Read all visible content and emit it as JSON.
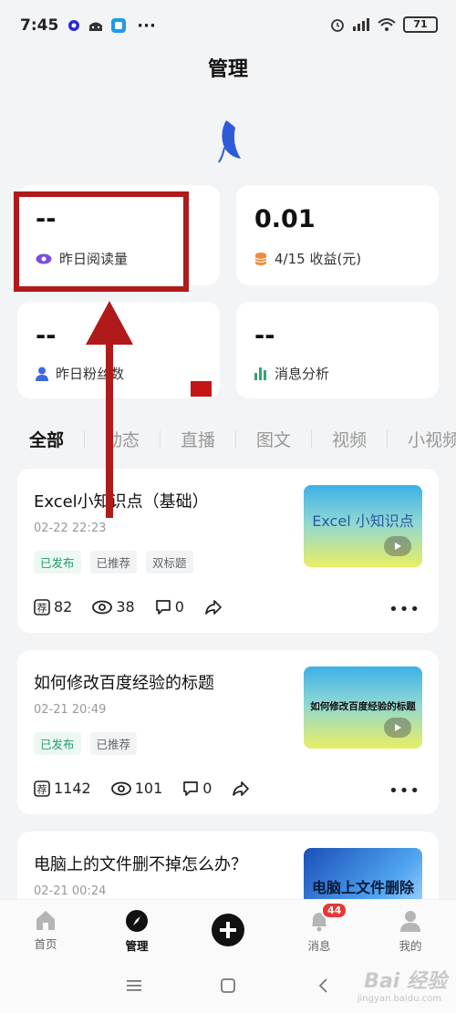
{
  "status_bar": {
    "time": "7:45",
    "battery": "71"
  },
  "header": {
    "title": "管理"
  },
  "stats": [
    {
      "value": "--",
      "label": "昨日阅读量",
      "icon": "eye-icon"
    },
    {
      "value": "0.01",
      "label": "4/15 收益(元)",
      "icon": "coins-icon"
    },
    {
      "value": "--",
      "label": "昨日粉丝数",
      "icon": "person-icon"
    },
    {
      "value": "--",
      "label": "消息分析",
      "icon": "bar-chart-icon"
    }
  ],
  "tabs": [
    "全部",
    "动态",
    "直播",
    "图文",
    "视频",
    "小视频"
  ],
  "active_tab": "全部",
  "articles": [
    {
      "title": "Excel小知识点（基础）",
      "date": "02-22 22:23",
      "tags": [
        "已发布",
        "已推荐",
        "双标题"
      ],
      "thumb_text": "Excel 小知识点",
      "recommend": "82",
      "views": "38",
      "comments": "0"
    },
    {
      "title": "如何修改百度经验的标题",
      "date": "02-21 20:49",
      "tags": [
        "已发布",
        "已推荐"
      ],
      "thumb_text": "如何修改百度经验的标题",
      "recommend": "1142",
      "views": "101",
      "comments": "0"
    },
    {
      "title": "电脑上的文件删不掉怎么办？",
      "date": "02-21 00:24",
      "thumb_text": "电脑上文件删除"
    }
  ],
  "bottom_nav": {
    "home": "首页",
    "manage": "管理",
    "messages": "消息",
    "mine": "我的",
    "message_badge": "44"
  },
  "colors": {
    "highlight": "#b11a1a",
    "accent_green": "#1f9c6a",
    "badge_red": "#e53935"
  },
  "watermark": {
    "text": "Bai 经验",
    "sub": "jingyan.baidu.com"
  }
}
